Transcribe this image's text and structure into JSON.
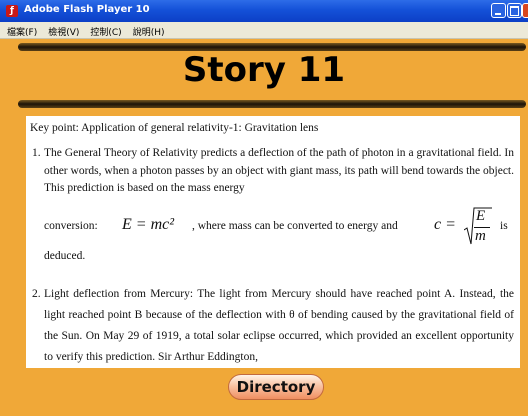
{
  "window": {
    "title": "Adobe Flash Player 10",
    "app_icon": "flash-player-icon"
  },
  "menu": [
    "檔案(F)",
    "檢視(V)",
    "控制(C)",
    "說明(H)"
  ],
  "page": {
    "title": "Story 11"
  },
  "content": {
    "key_point": "Key point: Application of general relativity-1: Gravitation lens",
    "item1_num": "1.",
    "item1_text": "The General Theory of Relativity predicts a deflection of the path of photon in a gravitational field. In other words, when a photon passes by an object with giant mass, its path will bend towards the object. This prediction is based on the mass energy",
    "item1_conv_prefix": "conversion:",
    "item1_eq1": "E = mc²",
    "item1_conv_mid": ", where mass can be converted to energy and",
    "item1_eq2": "c =",
    "item1_frac_num": "E",
    "item1_frac_den": "m",
    "item1_conv_end": "is",
    "item1_deduced": "deduced.",
    "item2_num": "2.",
    "item2_text": "Light deflection from Mercury: The light from Mercury should have reached point A. Instead, the light reached point B because of the deflection with θ of bending caused by the gravitational field of the Sun. On May 29 of 1919, a total solar eclipse occurred, which provided an excellent opportunity to verify this prediction. Sir Arthur Eddington,"
  },
  "directory_button": "Directory"
}
